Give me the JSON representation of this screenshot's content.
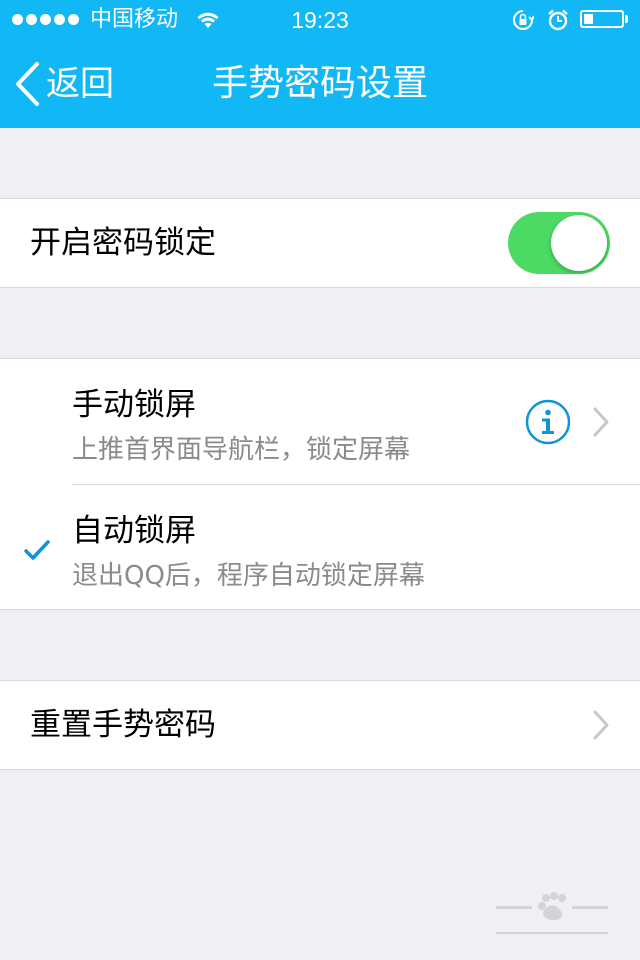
{
  "status_bar": {
    "carrier": "中国移动",
    "time": "19:23",
    "battery_level": 0.25
  },
  "nav": {
    "back_label": "返回",
    "title": "手势密码设置"
  },
  "settings": {
    "password_lock": {
      "label": "开启密码锁定",
      "enabled": true
    },
    "lock_modes": [
      {
        "title": "手动锁屏",
        "subtitle": "上推首界面导航栏，锁定屏幕",
        "selected": false
      },
      {
        "title": "自动锁屏",
        "subtitle": "退出QQ后，程序自动锁定屏幕",
        "selected": true
      }
    ],
    "reset": {
      "label": "重置手势密码"
    }
  },
  "colors": {
    "nav_bar": "#12b7f5",
    "toggle_on": "#4cd964",
    "accent": "#0e95d6",
    "background": "#efeff4"
  },
  "icons": [
    "wifi-icon",
    "rotation-lock-icon",
    "alarm-icon",
    "battery-icon",
    "back-chevron-icon",
    "info-icon",
    "chevron-right-icon",
    "checkmark-icon"
  ]
}
